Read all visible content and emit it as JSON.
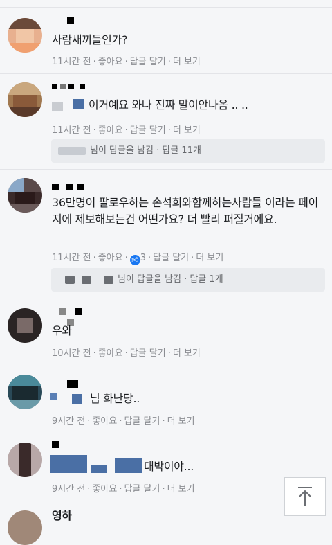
{
  "comments": [
    {
      "text": "사람새끼들인가?",
      "time": "11시간 전",
      "like": "좋아요",
      "reply": "답글 달기",
      "more": "더 보기"
    },
    {
      "text": "이거예요 와나 진짜 말이안나옴 .. ..",
      "time": "11시간 전",
      "like": "좋아요",
      "reply": "답글 달기",
      "more": "더 보기",
      "reply_summary": "님이 답글을 남김 · 답글 11개"
    },
    {
      "text": "36만명이 팔로우하는 손석희와함께하는사람들 이라는 페이지에 제보해보는건 어떤가요? 더 빨리 퍼질거에요.",
      "time": "11시간 전",
      "like": "좋아요",
      "like_count": "3",
      "reply": "답글 달기",
      "more": "더 보기",
      "reply_summary": "님이 답글을 남김 · 답글 1개"
    },
    {
      "text": "우와",
      "time": "10시간 전",
      "like": "좋아요",
      "reply": "답글 달기",
      "more": "더 보기"
    },
    {
      "text": "님 화난당..",
      "time": "9시간 전",
      "like": "좋아요",
      "reply": "답글 달기",
      "more": "더 보기"
    },
    {
      "text": "대박이야...",
      "time": "9시간 전",
      "like": "좋아요",
      "reply": "답글 달기",
      "more": "더 보기"
    },
    {
      "text": "영하"
    }
  ],
  "separator": "·",
  "icons": {
    "scroll_top": "arrow-up-icon",
    "like": "thumbs-up-icon"
  },
  "colors": {
    "like_blue": "#1877f2",
    "meta_gray": "#8b8d92"
  }
}
